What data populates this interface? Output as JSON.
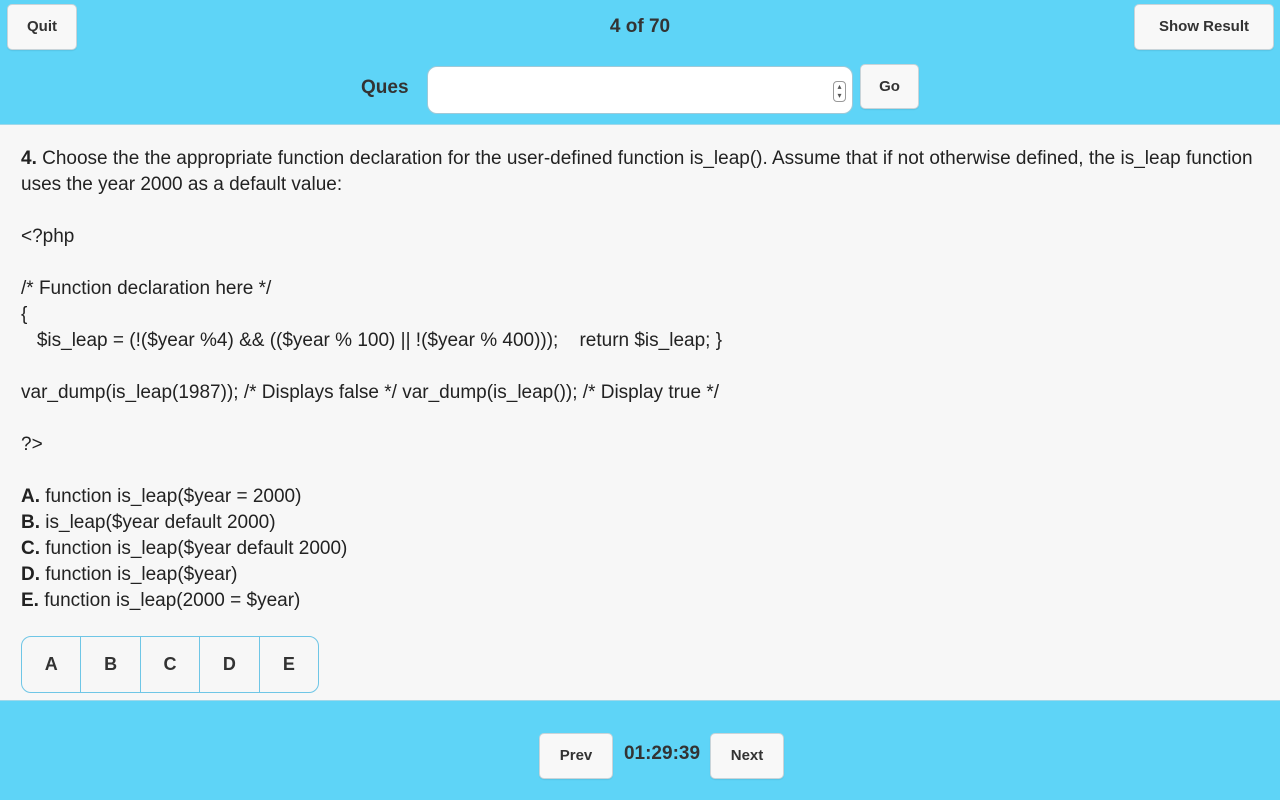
{
  "header": {
    "quit_label": "Quit",
    "counter": "4 of 70",
    "show_result_label": "Show Result",
    "ques_label": "Ques",
    "ques_value": "",
    "go_label": "Go"
  },
  "question": {
    "number": "4.",
    "text": " Choose the the appropriate function declaration for the user-defined function is_leap(). Assume that if not otherwise defined, the is_leap function uses the year 2000 as a default value:",
    "code": {
      "open_tag": "<?php",
      "comment": "/* Function declaration here */",
      "brace": "{",
      "body": "   $is_leap = (!($year %4) && (($year % 100) || !($year % 400)));    return $is_leap; }",
      "dump": "var_dump(is_leap(1987)); /* Displays false */ var_dump(is_leap()); /* Display true */",
      "close_tag": "?>"
    },
    "options": [
      {
        "letter": "A.",
        "text": " function is_leap($year = 2000)"
      },
      {
        "letter": "B.",
        "text": " is_leap($year default 2000)"
      },
      {
        "letter": "C.",
        "text": " function is_leap($year default 2000)"
      },
      {
        "letter": "D.",
        "text": " function is_leap($year)"
      },
      {
        "letter": "E.",
        "text": " function is_leap(2000 = $year)"
      }
    ]
  },
  "answers": [
    "A",
    "B",
    "C",
    "D",
    "E"
  ],
  "footer": {
    "prev_label": "Prev",
    "timer": "01:29:39",
    "next_label": "Next"
  },
  "colors": {
    "bar_background": "#5ed4f7",
    "content_background": "#f7f7f7",
    "answer_border": "#6fc6e6"
  }
}
